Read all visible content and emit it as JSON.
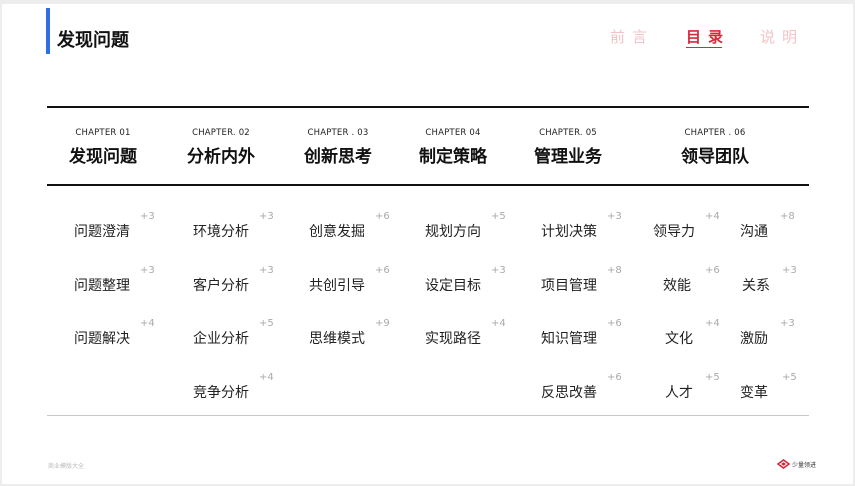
{
  "header": {
    "title": "发现问题"
  },
  "top_nav": [
    {
      "label": "前言",
      "state": "muted"
    },
    {
      "label": "目录",
      "state": "active"
    },
    {
      "label": "说明",
      "state": "muted"
    }
  ],
  "chapters": [
    {
      "label": "CHAPTER 01",
      "title": "发现问题",
      "items": [
        {
          "label": "问题澄清",
          "count": "+3"
        },
        {
          "label": "问题整理",
          "count": "+3"
        },
        {
          "label": "问题解决",
          "count": "+4"
        }
      ]
    },
    {
      "label": "CHAPTER. 02",
      "title": "分析内外",
      "items": [
        {
          "label": "环境分析",
          "count": "+3"
        },
        {
          "label": "客户分析",
          "count": "+3"
        },
        {
          "label": "企业分析",
          "count": "+5"
        },
        {
          "label": "竞争分析",
          "count": "+4"
        }
      ]
    },
    {
      "label": "CHAPTER . 03",
      "title": "创新思考",
      "items": [
        {
          "label": "创意发掘",
          "count": "+6"
        },
        {
          "label": "共创引导",
          "count": "+6"
        },
        {
          "label": "思维模式",
          "count": "+9"
        }
      ]
    },
    {
      "label": "CHAPTER 04",
      "title": "制定策略",
      "items": [
        {
          "label": "规划方向",
          "count": "+5"
        },
        {
          "label": "设定目标",
          "count": "+3"
        },
        {
          "label": "实现路径",
          "count": "+4"
        }
      ]
    },
    {
      "label": "CHAPTER. 05",
      "title": "管理业务",
      "items": [
        {
          "label": "计划决策",
          "count": "+3"
        },
        {
          "label": "项目管理",
          "count": "+8"
        },
        {
          "label": "知识管理",
          "count": "+6"
        },
        {
          "label": "反思改善",
          "count": "+6"
        }
      ]
    },
    {
      "label": "CHAPTER . 06",
      "title": "领导团队",
      "items_left": [
        {
          "label": "领导力",
          "count": "+4"
        },
        {
          "label": "效能",
          "count": "+6"
        },
        {
          "label": "文化",
          "count": "+4"
        },
        {
          "label": "人才",
          "count": "+5"
        }
      ],
      "items_right": [
        {
          "label": "沟通",
          "count": "+8"
        },
        {
          "label": "关系",
          "count": "+3"
        },
        {
          "label": "激励",
          "count": "+3"
        },
        {
          "label": "变革",
          "count": "+5"
        }
      ]
    }
  ],
  "footer": {
    "left_text": "商业模版大全",
    "logo_text": "少量领进"
  },
  "colors": {
    "accent_blue": "#2f6fe4",
    "active_red": "#d9283a",
    "muted_pink": "#f2c4c8"
  }
}
